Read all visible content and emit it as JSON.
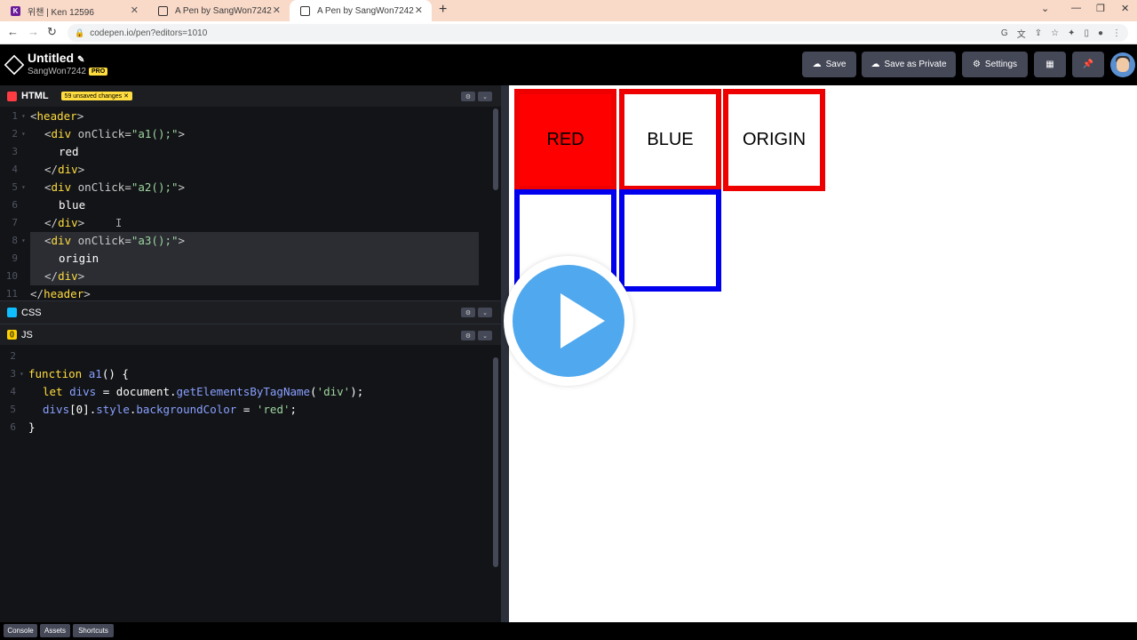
{
  "browser": {
    "tabs": [
      {
        "label": "위챈 | Ken 12596",
        "icon": "K",
        "color": "#6a1b9a"
      },
      {
        "label": "A Pen by SangWon7242",
        "icon": "codepen"
      },
      {
        "label": "A Pen by SangWon7242",
        "icon": "codepen",
        "active": true
      }
    ],
    "new_tab": "+",
    "url": "codepen.io/pen?editors=1010"
  },
  "codepen": {
    "title": "Untitled",
    "user": "SangWon7242",
    "pro_badge": "PRO",
    "buttons": {
      "save": "Save",
      "save_private": "Save as Private",
      "settings": "Settings"
    }
  },
  "html_panel": {
    "label": "HTML",
    "unsaved": "59 unsaved changes",
    "lines": [
      "1",
      "2",
      "3",
      "4",
      "5",
      "6",
      "7",
      "8",
      "9",
      "10",
      "11"
    ]
  },
  "css_panel": {
    "label": "CSS"
  },
  "js_panel": {
    "label": "JS",
    "lines": [
      "2",
      "3",
      "4",
      "5",
      "6"
    ]
  },
  "preview": {
    "boxes": [
      {
        "label": "RED",
        "border": "#ee0000",
        "fill": "#ff0000"
      },
      {
        "label": "BLUE",
        "border": "#ee0000",
        "fill": "#ffffff"
      },
      {
        "label": "ORIGIN",
        "border": "#ee0000",
        "fill": "#ffffff"
      },
      {
        "label": "",
        "border": "#0000ee",
        "fill": "#ffffff"
      },
      {
        "label": "",
        "border": "#0000ee",
        "fill": "#ffffff"
      }
    ]
  },
  "footer": {
    "console": "Console",
    "assets": "Assets",
    "shortcuts": "Shortcuts"
  },
  "colors": {
    "accent_yellow": "#ffdd40",
    "play_blue": "#50a8ee",
    "editor_bg": "#131417"
  }
}
